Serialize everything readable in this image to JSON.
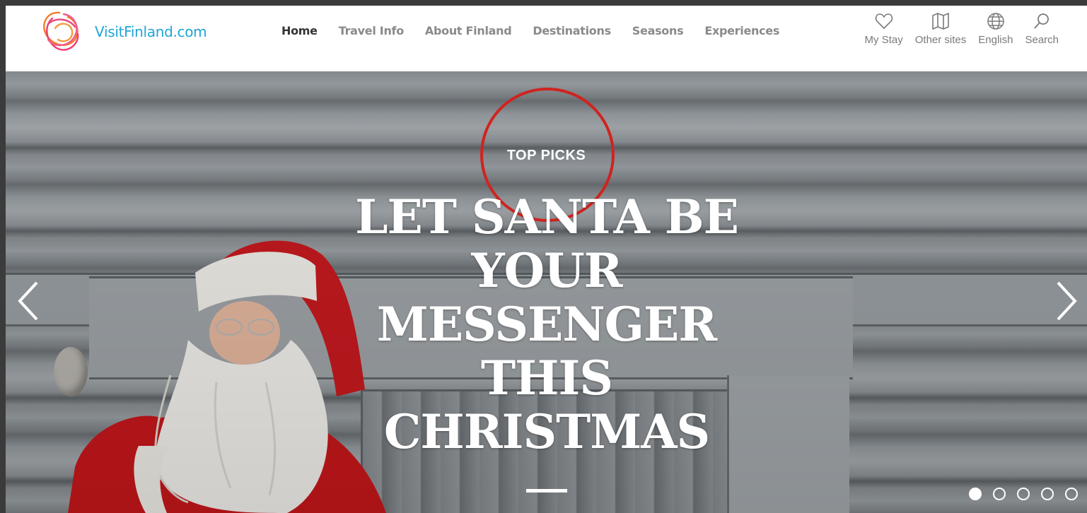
{
  "brand": {
    "name": "VisitFinland.com"
  },
  "nav": [
    {
      "label": "Home",
      "active": true
    },
    {
      "label": "Travel Info",
      "active": false
    },
    {
      "label": "About Finland",
      "active": false
    },
    {
      "label": "Destinations",
      "active": false
    },
    {
      "label": "Seasons",
      "active": false
    },
    {
      "label": "Experiences",
      "active": false
    }
  ],
  "utilities": [
    {
      "label": "My Stay",
      "icon": "heart-icon"
    },
    {
      "label": "Other sites",
      "icon": "map-icon"
    },
    {
      "label": "English",
      "icon": "globe-icon"
    },
    {
      "label": "Search",
      "icon": "search-icon"
    }
  ],
  "hero": {
    "tag": "TOP PICKS",
    "headline": "LET SANTA BE YOUR MESSENGER THIS CHRISTMAS",
    "slide_count": 5,
    "active_slide": 1
  },
  "colors": {
    "brand_blue": "#1fa5d6",
    "highlight_red": "#d0231f",
    "nav_active": "#333333",
    "nav_inactive": "#8a8a8a"
  }
}
